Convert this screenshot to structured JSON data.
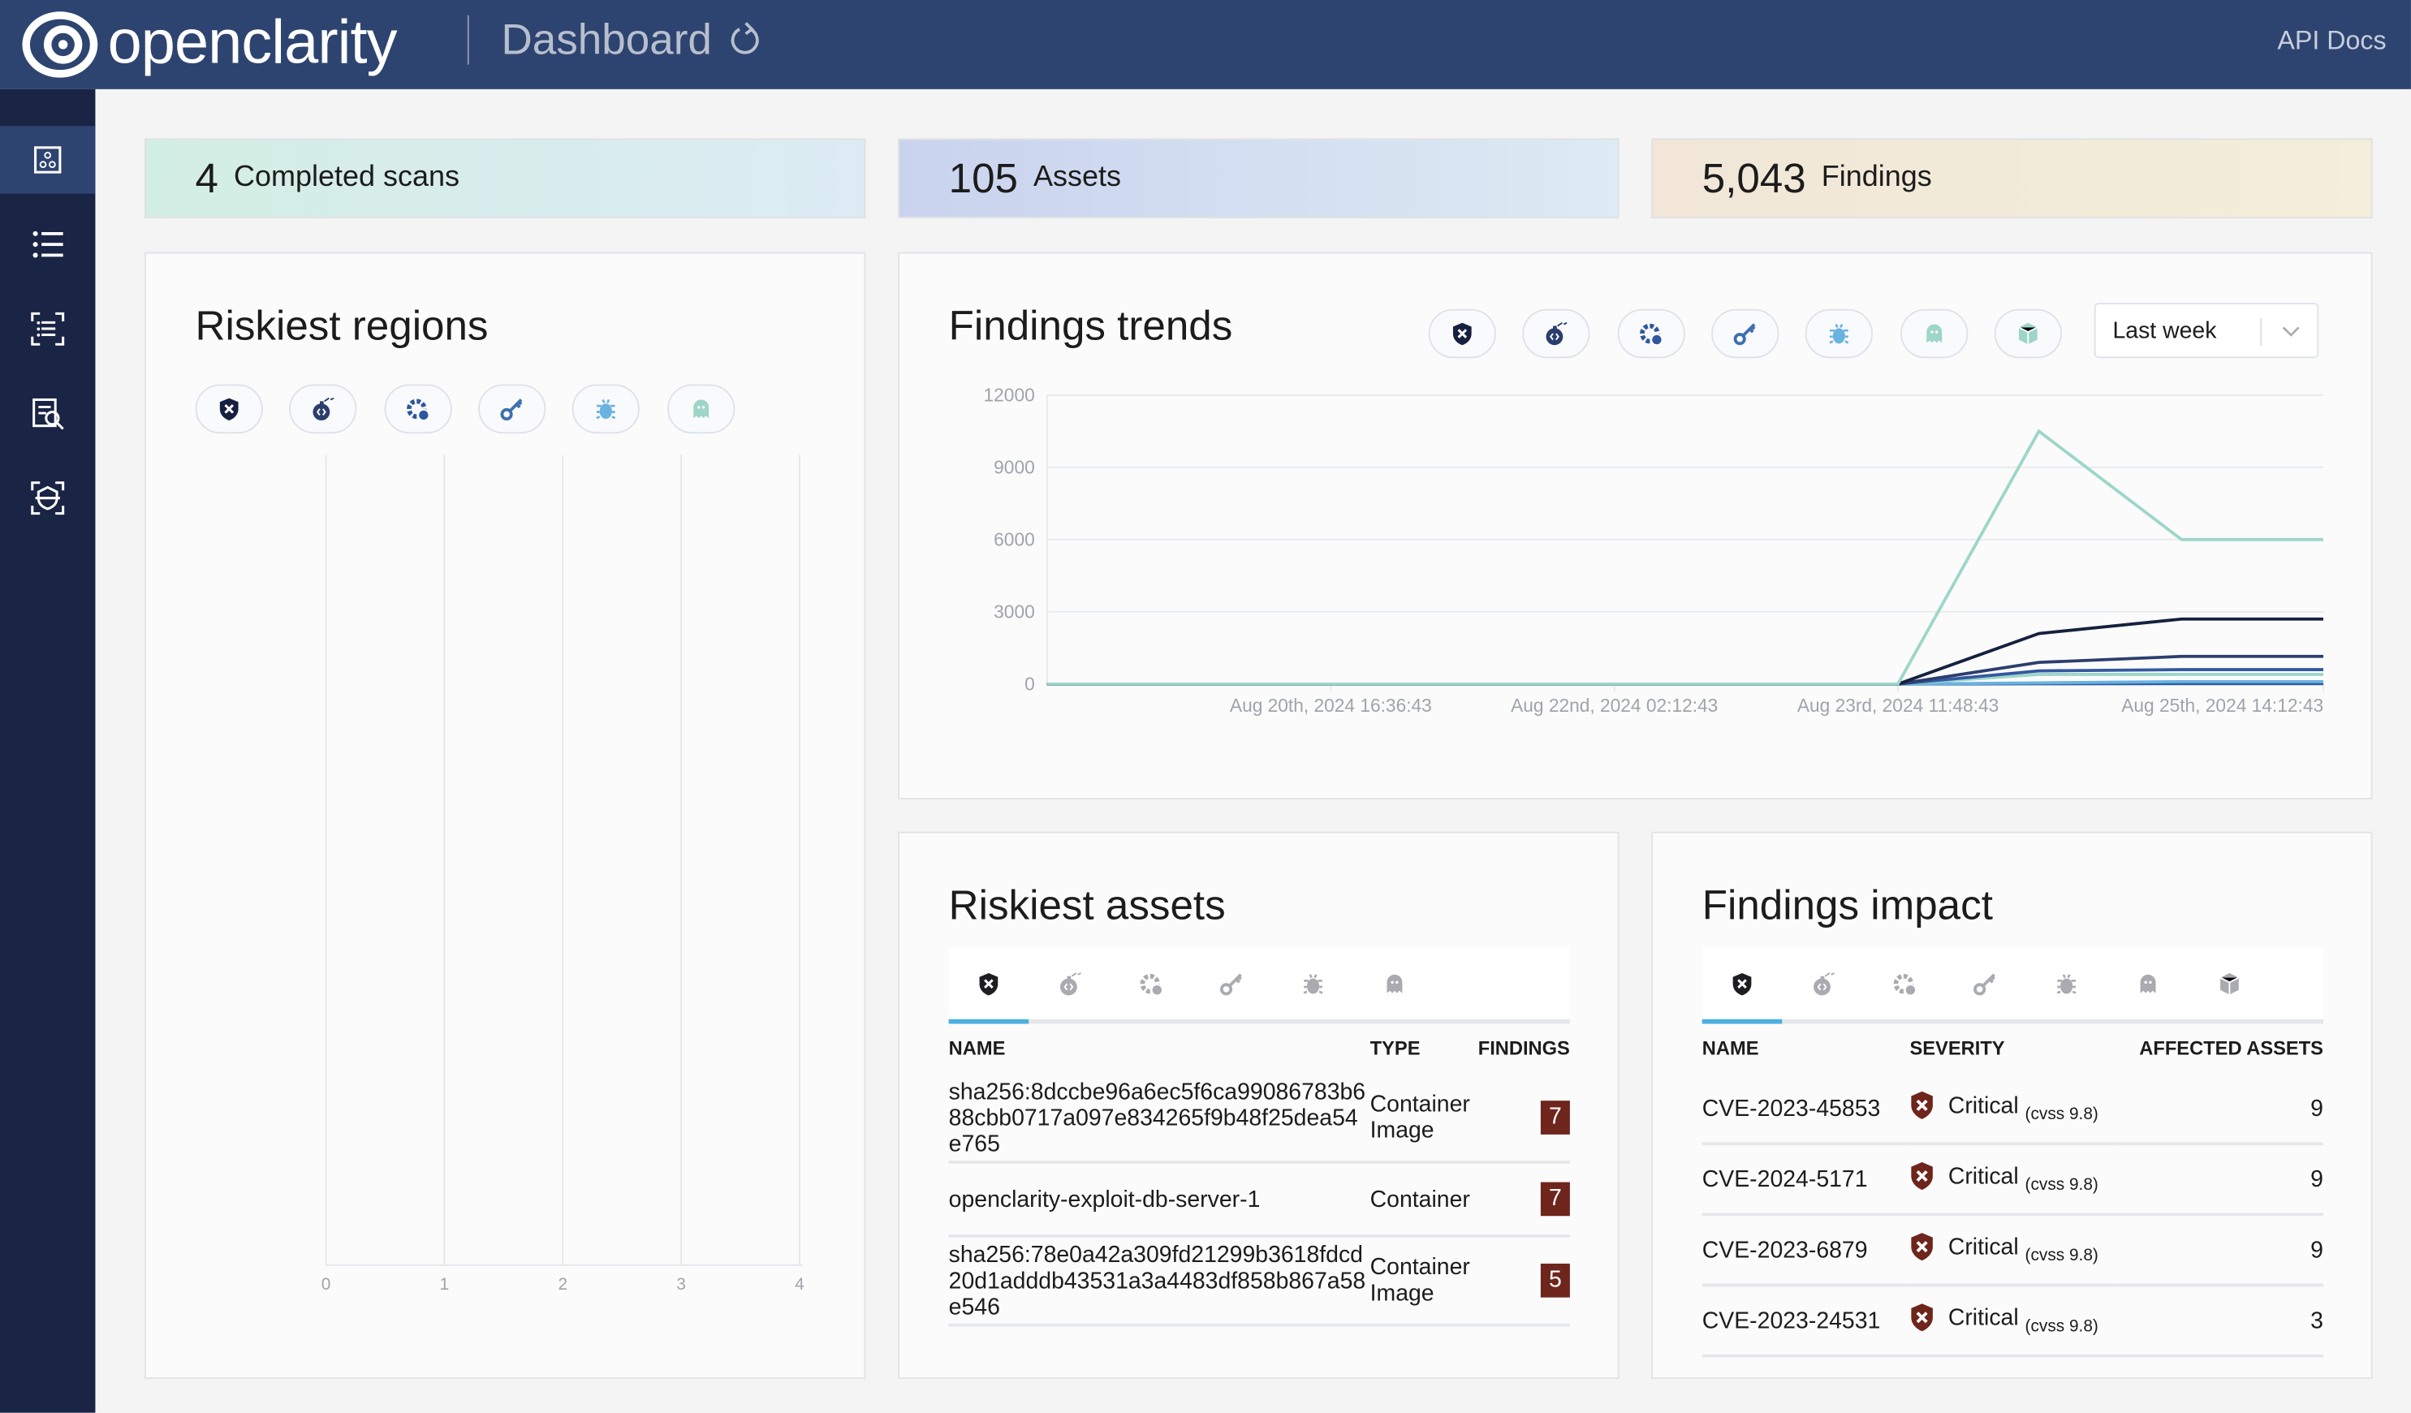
{
  "header": {
    "brand": "openclarity",
    "page_title": "Dashboard",
    "api_docs": "API Docs"
  },
  "sidebar": {
    "items": [
      {
        "icon": "dashboard-icon",
        "active": true
      },
      {
        "icon": "findings-list-icon"
      },
      {
        "icon": "assets-icon"
      },
      {
        "icon": "asset-scans-icon"
      },
      {
        "icon": "scans-icon"
      }
    ]
  },
  "stats": [
    {
      "value": "4",
      "label": "Completed scans"
    },
    {
      "value": "105",
      "label": "Assets"
    },
    {
      "value": "5,043",
      "label": "Findings"
    }
  ],
  "finding_types": [
    "vulnerabilities",
    "exploits",
    "misconfigurations",
    "secrets",
    "malware",
    "rootkits",
    "packages"
  ],
  "colors": {
    "header": "#2e4470",
    "sidebar": "#1a2444",
    "badge": "#6e251c",
    "active_tab": "#4ab0e0",
    "critical": "#6e251c"
  },
  "riskiest_regions": {
    "title": "Riskiest regions",
    "chart_data": {
      "type": "bar",
      "orientation": "horizontal",
      "categories": [],
      "values": [],
      "xticks": [
        "0",
        "1",
        "2",
        "3",
        "4"
      ],
      "xlim": [
        0,
        4
      ],
      "grid": true
    }
  },
  "findings_trends": {
    "title": "Findings trends",
    "range": "Last week",
    "chart_data": {
      "type": "line",
      "x": [
        "2024-08-19T07:00",
        "2024-08-23T11:48",
        "2024-08-24T04:30",
        "2024-08-24T21:24",
        "2024-08-25T14:12"
      ],
      "xticks": [
        "Aug 20th, 2024 16:36:43",
        "Aug 22nd, 2024 02:12:43",
        "Aug 23rd, 2024 11:48:43",
        "Aug 25th, 2024 14:12:43"
      ],
      "yticks": [
        "0",
        "3000",
        "6000",
        "9000",
        "12000"
      ],
      "ylim": [
        0,
        12000
      ],
      "grid": true,
      "series": [
        {
          "color": "#9dd6c8",
          "values": [
            0,
            0,
            10500,
            6000,
            6000
          ]
        },
        {
          "color": "#16213f",
          "values": [
            0,
            0,
            2100,
            2700,
            2700
          ]
        },
        {
          "color": "#2b3e6e",
          "values": [
            0,
            0,
            900,
            1150,
            1150
          ]
        },
        {
          "color": "#3458a0",
          "values": [
            0,
            0,
            550,
            600,
            600
          ]
        },
        {
          "color": "#9dd6c8",
          "values": [
            0,
            0,
            400,
            400,
            400
          ]
        },
        {
          "color": "#6ab2e0",
          "values": [
            0,
            0,
            50,
            100,
            100
          ]
        },
        {
          "color": "#2b5ea8",
          "values": [
            0,
            0,
            10,
            20,
            20
          ]
        }
      ]
    }
  },
  "riskiest_assets": {
    "title": "Riskiest assets",
    "columns": [
      "NAME",
      "TYPE",
      "FINDINGS"
    ],
    "rows": [
      {
        "name": "sha256:8dccbe96a6ec5f6ca99086783b688cbb0717a097e834265f9b48f25dea54e765",
        "type": "Container Image",
        "findings": "7"
      },
      {
        "name": "openclarity-exploit-db-server-1",
        "type": "Container",
        "findings": "7"
      },
      {
        "name": "sha256:78e0a42a309fd21299b3618fdcd20d1adddb43531a3a4483df858b867a58e546",
        "type": "Container Image",
        "findings": "5"
      }
    ]
  },
  "findings_impact": {
    "title": "Findings impact",
    "columns": [
      "NAME",
      "SEVERITY",
      "AFFECTED ASSETS"
    ],
    "rows": [
      {
        "name": "CVE-2023-45853",
        "severity": "Critical",
        "score": "(cvss 9.8)",
        "assets": "9"
      },
      {
        "name": "CVE-2024-5171",
        "severity": "Critical",
        "score": "(cvss 9.8)",
        "assets": "9"
      },
      {
        "name": "CVE-2023-6879",
        "severity": "Critical",
        "score": "(cvss 9.8)",
        "assets": "9"
      },
      {
        "name": "CVE-2023-24531",
        "severity": "Critical",
        "score": "(cvss 9.8)",
        "assets": "3"
      }
    ]
  }
}
